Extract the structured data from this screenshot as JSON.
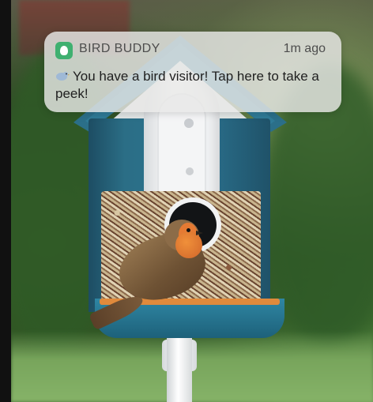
{
  "notification": {
    "app_name": "BIRD BUDDY",
    "time": "1m ago",
    "message": "You have a bird visitor! Tap here to take a peek!",
    "icon": "bird-icon",
    "accent_color": "#3fb070"
  }
}
